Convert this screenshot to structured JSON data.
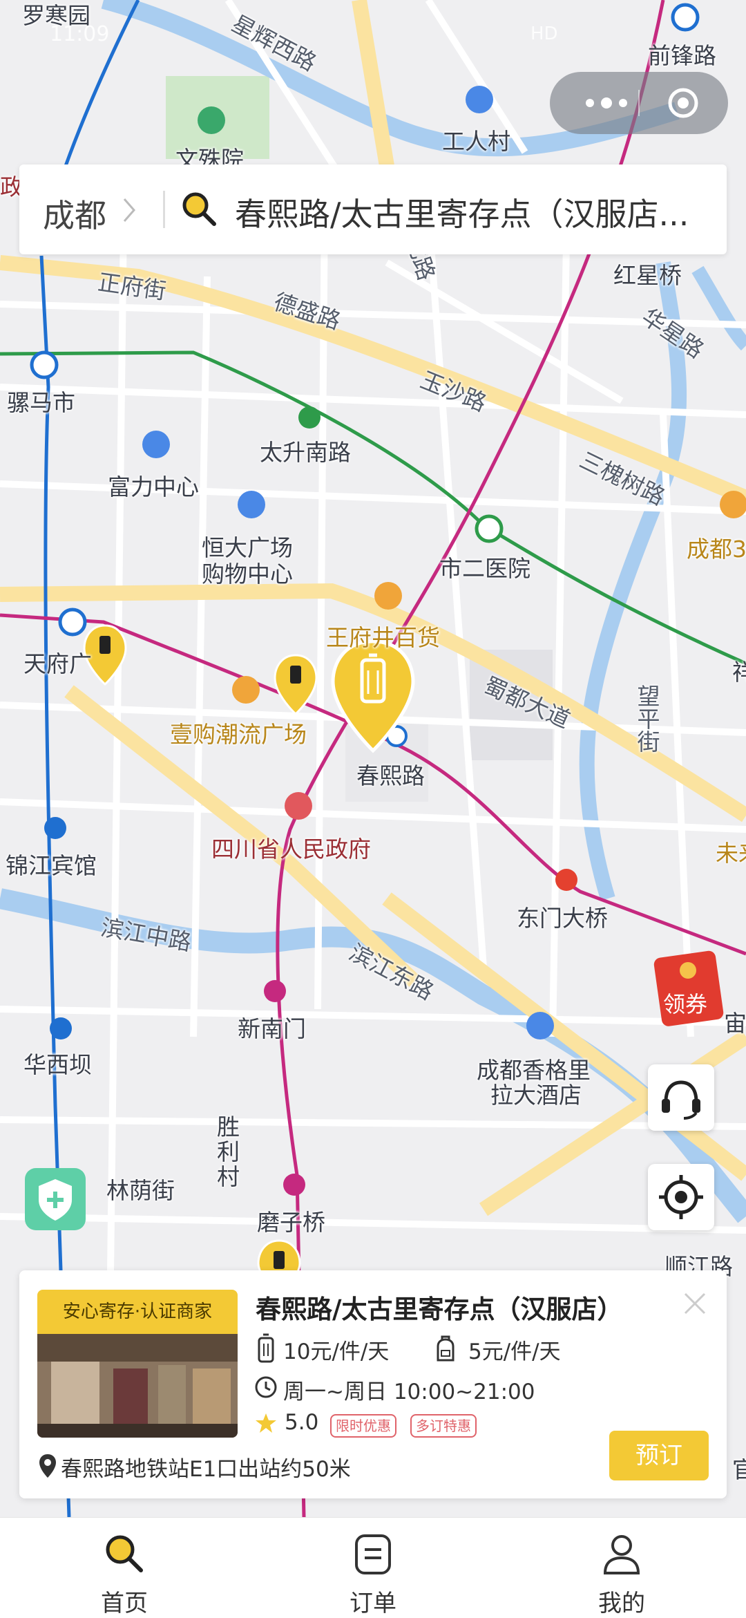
{
  "status_bar": {
    "time": "11:09",
    "network": "HD"
  },
  "search": {
    "city": "成都",
    "query": "春熙路/太古里寄存点（汉服店..."
  },
  "map": {
    "road_labels": [
      "星辉西路",
      "正府街",
      "德盛路",
      "玉沙路",
      "三槐树路",
      "华星路",
      "蜀都大道",
      "滨江中路",
      "滨江东路",
      "望平街",
      "北路"
    ],
    "place_labels": [
      "罗寒园",
      "工人村",
      "文殊院",
      "前锋路",
      "红星桥",
      "骡马市",
      "太升南路",
      "富力中心",
      "恒大广场",
      "购物中心",
      "市二医院",
      "成都3",
      "天府广",
      "王府井百货",
      "壹购潮流广场",
      "春熙路",
      "四川省人民政府",
      "锦江宾馆",
      "东门大桥",
      "未来",
      "新南门",
      "华西坝",
      "成都香格里",
      "拉大酒店",
      "胜",
      "利",
      "村",
      "林荫街",
      "磨子桥",
      "顺江路",
      "宙",
      "官",
      "政",
      "祥"
    ]
  },
  "capsule": {
    "more_icon": "more-dots-icon",
    "close_icon": "target-ring-icon"
  },
  "floating": {
    "coupon_label": "领券",
    "service_icon": "headset-icon",
    "locate_icon": "locate-icon",
    "shield_icon": "shield-plus-icon"
  },
  "card": {
    "badge": "安心寄存·认证商家",
    "name": "春熙路/太古里寄存点（汉服店）",
    "price_large": "10元/件/天",
    "price_small": "5元/件/天",
    "hours": "周一~周日 10:00~21:00",
    "rating": "5.0",
    "tags": [
      "限时优惠",
      "多订特惠"
    ],
    "address": "春熙路地铁站E1口出站约50米",
    "book_label": "预订"
  },
  "tabs": [
    {
      "label": "首页",
      "icon": "search-icon",
      "active": true
    },
    {
      "label": "订单",
      "icon": "order-icon",
      "active": false
    },
    {
      "label": "我的",
      "icon": "user-icon",
      "active": false
    }
  ],
  "colors": {
    "accent": "#f3c935",
    "metro_blue": "#1f6fd0",
    "metro_green": "#2e9b4a",
    "metro_magenta": "#c5297f",
    "river": "#a9cdf0",
    "main_road": "#fbe3a0"
  }
}
